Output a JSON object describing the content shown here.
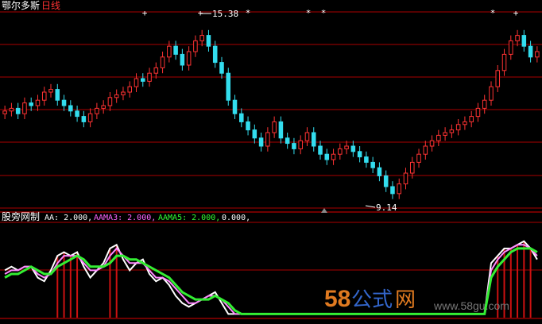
{
  "top_panel": {
    "stock_name": "鄂尔多斯",
    "period": "日线",
    "max_label": "15.38",
    "min_label": "9.14"
  },
  "bottom_panel": {
    "indicator_name": "股旁网制",
    "legend": [
      {
        "text": "AA: 2.000,",
        "color": "#ffffff"
      },
      {
        "text": "AAMA3: 2.000,",
        "color": "#ff66ff"
      },
      {
        "text": "AAMA5: 2.000,",
        "color": "#33ff33"
      },
      {
        "text": "0.000,",
        "color": "#ffffff"
      }
    ]
  },
  "watermark": {
    "brand_num": "58",
    "brand_a": "公式",
    "brand_b": "网",
    "url": "www.58gu.com"
  },
  "colors": {
    "up": "#ff3333",
    "down": "#33ddee",
    "grid": "#aa0000",
    "aa": "#ffffff",
    "ma3": "#ff88ff",
    "ma5": "#33ee33"
  },
  "chart_data": {
    "type": "candlestick",
    "ylim": [
      8.9,
      15.9
    ],
    "price_close": [
      12.2,
      12.3,
      12.1,
      12.5,
      12.4,
      12.6,
      12.9,
      13.0,
      12.6,
      12.4,
      12.2,
      12.0,
      11.8,
      12.1,
      12.3,
      12.4,
      12.7,
      12.8,
      12.9,
      13.1,
      13.4,
      13.3,
      13.6,
      13.8,
      14.2,
      14.6,
      14.3,
      13.9,
      14.4,
      14.8,
      15.0,
      14.6,
      14.0,
      13.6,
      12.6,
      12.1,
      11.8,
      11.5,
      11.2,
      10.9,
      11.4,
      11.8,
      11.2,
      11.0,
      10.8,
      11.1,
      11.4,
      10.9,
      10.6,
      10.4,
      10.6,
      10.8,
      10.9,
      10.7,
      10.5,
      10.3,
      10.1,
      9.8,
      9.4,
      9.14,
      9.5,
      9.9,
      10.3,
      10.6,
      10.9,
      11.1,
      11.3,
      11.4,
      11.5,
      11.7,
      11.8,
      12.0,
      12.3,
      12.6,
      13.1,
      13.7,
      14.3,
      14.8,
      15.0,
      14.6,
      14.2,
      14.4
    ],
    "price_high": 15.38,
    "price_low": 9.14,
    "indicator_ylim": [
      -0.1,
      2.3
    ],
    "series": [
      {
        "name": "AA",
        "values": [
          1.2,
          1.3,
          1.2,
          1.3,
          1.3,
          1.0,
          0.9,
          1.2,
          1.6,
          1.7,
          1.6,
          1.7,
          1.3,
          1.0,
          1.2,
          1.4,
          1.8,
          1.9,
          1.5,
          1.2,
          1.4,
          1.5,
          1.1,
          0.9,
          1.0,
          0.8,
          0.5,
          0.3,
          0.2,
          0.3,
          0.4,
          0.5,
          0.6,
          0.3,
          0.0,
          0.0,
          0.0,
          0.0,
          0.0,
          0.0,
          0.0,
          0.0,
          0.0,
          0.0,
          0.0,
          0.0,
          0.0,
          0.0,
          0.0,
          0.0,
          0.0,
          0.0,
          0.0,
          0.0,
          0.0,
          0.0,
          0.0,
          0.0,
          0.0,
          0.0,
          0.0,
          0.0,
          0.0,
          0.0,
          0.0,
          0.0,
          0.0,
          0.0,
          0.0,
          0.0,
          0.0,
          0.0,
          0.0,
          0.0,
          1.4,
          1.6,
          1.8,
          1.8,
          1.9,
          2.0,
          1.8,
          1.5
        ]
      },
      {
        "name": "AAMA3",
        "values": [
          1.1,
          1.2,
          1.2,
          1.3,
          1.3,
          1.1,
          1.0,
          1.1,
          1.4,
          1.6,
          1.6,
          1.6,
          1.4,
          1.2,
          1.2,
          1.3,
          1.6,
          1.8,
          1.6,
          1.4,
          1.4,
          1.4,
          1.2,
          1.0,
          1.0,
          0.9,
          0.7,
          0.5,
          0.3,
          0.3,
          0.4,
          0.5,
          0.5,
          0.4,
          0.2,
          0.0,
          0.0,
          0.0,
          0.0,
          0.0,
          0.0,
          0.0,
          0.0,
          0.0,
          0.0,
          0.0,
          0.0,
          0.0,
          0.0,
          0.0,
          0.0,
          0.0,
          0.0,
          0.0,
          0.0,
          0.0,
          0.0,
          0.0,
          0.0,
          0.0,
          0.0,
          0.0,
          0.0,
          0.0,
          0.0,
          0.0,
          0.0,
          0.0,
          0.0,
          0.0,
          0.0,
          0.0,
          0.0,
          0.0,
          1.2,
          1.5,
          1.7,
          1.8,
          1.9,
          1.9,
          1.8,
          1.6
        ]
      },
      {
        "name": "AAMA5",
        "values": [
          1.0,
          1.1,
          1.1,
          1.2,
          1.3,
          1.2,
          1.1,
          1.1,
          1.3,
          1.4,
          1.5,
          1.6,
          1.5,
          1.3,
          1.3,
          1.3,
          1.4,
          1.6,
          1.6,
          1.5,
          1.5,
          1.4,
          1.3,
          1.2,
          1.1,
          1.0,
          0.8,
          0.6,
          0.5,
          0.4,
          0.4,
          0.4,
          0.5,
          0.4,
          0.3,
          0.1,
          0.0,
          0.0,
          0.0,
          0.0,
          0.0,
          0.0,
          0.0,
          0.0,
          0.0,
          0.0,
          0.0,
          0.0,
          0.0,
          0.0,
          0.0,
          0.0,
          0.0,
          0.0,
          0.0,
          0.0,
          0.0,
          0.0,
          0.0,
          0.0,
          0.0,
          0.0,
          0.0,
          0.0,
          0.0,
          0.0,
          0.0,
          0.0,
          0.0,
          0.0,
          0.0,
          0.0,
          0.0,
          0.0,
          1.0,
          1.3,
          1.5,
          1.7,
          1.8,
          1.8,
          1.8,
          1.7
        ]
      }
    ]
  }
}
